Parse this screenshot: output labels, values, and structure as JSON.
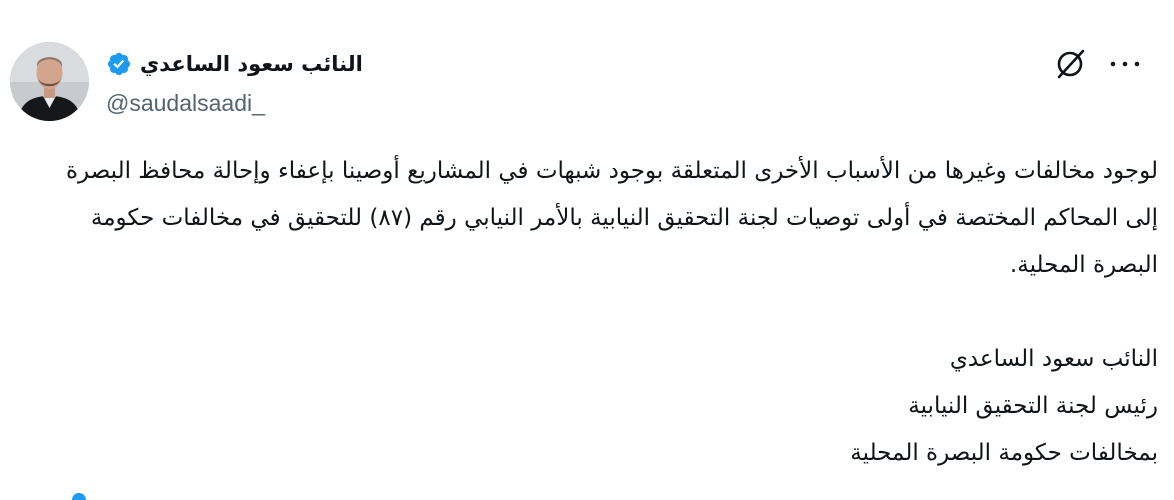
{
  "author": {
    "display_name": "النائب سعود الساعدي",
    "handle": "@saudalsaadi_",
    "verified": true,
    "avatar": "profile-photo"
  },
  "actions": {
    "grok_icon": "grok-slashed-circle-icon",
    "more_icon": "more-horizontal-icon"
  },
  "post": {
    "body_paragraph": "لوجود مخالفات وغيرها من الأسباب الأخرى المتعلقة بوجود شبهات في المشاريع أوصينا بإعفاء وإحالة محافظ البصرة إلى المحاكم المختصة في أولى توصيات لجنة التحقيق النيابية بالأمر النيابي رقم (٨٧) للتحقيق في مخالفات حكومة البصرة المحلية.",
    "signature": [
      "النائب سعود الساعدي",
      "رئيس لجنة التحقيق النيابية",
      "بمخالفات حكومة البصرة المحلية"
    ]
  },
  "colors": {
    "verified_badge": "#1d9bf0",
    "handle_text": "#536471",
    "body_text": "#0f1419"
  }
}
